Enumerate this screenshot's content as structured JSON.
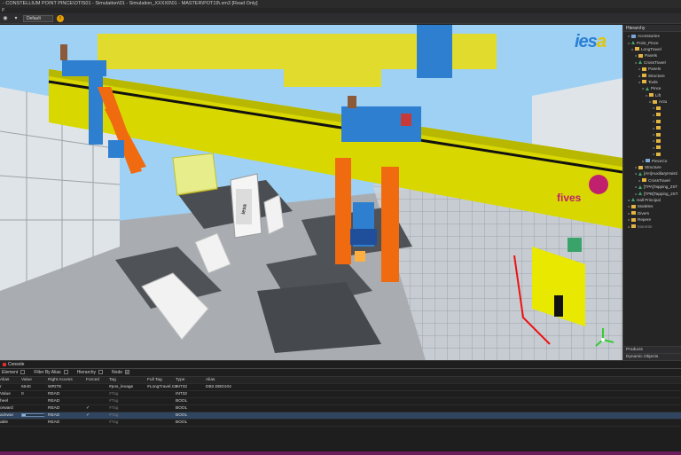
{
  "window": {
    "title": "- CONSTELLIUM POINT PINCE\\OTIS01 - Simulation\\01 - Simulation_XXXX0\\01 - MASTER\\POT19\\.xm3 [Read Only]"
  },
  "toolbar": {
    "select_value": "Default"
  },
  "viewport": {
    "logo_main": "ies",
    "logo_accent": "a",
    "sign_label": "fives",
    "board_label": "iesa"
  },
  "hierarchy": {
    "title": "Hierarchy",
    "items": [
      {
        "label": "Accessories",
        "depth": 1,
        "icon": "cube"
      },
      {
        "label": "Point_Pince",
        "depth": 1,
        "icon": "tri"
      },
      {
        "label": "LongTravel",
        "depth": 2,
        "icon": "folder"
      },
      {
        "label": "Panels",
        "depth": 3,
        "icon": "folder"
      },
      {
        "label": "CrossTravel",
        "depth": 3,
        "icon": "tri"
      },
      {
        "label": "Panels",
        "depth": 4,
        "icon": "folder"
      },
      {
        "label": "Structure",
        "depth": 4,
        "icon": "folder"
      },
      {
        "label": "Tools",
        "depth": 4,
        "icon": "folder"
      },
      {
        "label": "Pince",
        "depth": 5,
        "icon": "tri"
      },
      {
        "label": "Lift",
        "depth": 6,
        "icon": "folder"
      },
      {
        "label": "Actu",
        "depth": 7,
        "icon": "folder"
      },
      {
        "label": "",
        "depth": 8,
        "icon": "folder"
      },
      {
        "label": "",
        "depth": 8,
        "icon": "folder"
      },
      {
        "label": "",
        "depth": 8,
        "icon": "folder"
      },
      {
        "label": "",
        "depth": 8,
        "icon": "folder"
      },
      {
        "label": "",
        "depth": 8,
        "icon": "folder"
      },
      {
        "label": "",
        "depth": 8,
        "icon": "folder"
      },
      {
        "label": "",
        "depth": 8,
        "icon": "folder"
      },
      {
        "label": "",
        "depth": 8,
        "icon": "folder"
      },
      {
        "label": "PieceCo",
        "depth": 5,
        "icon": "cube"
      },
      {
        "label": "Structure",
        "depth": 3,
        "icon": "folder"
      },
      {
        "label": "[AH]AuxiliaryHoisti",
        "depth": 3,
        "icon": "tri"
      },
      {
        "label": "CrossTravel",
        "depth": 4,
        "icon": "folder"
      },
      {
        "label": "[TPA]Tapping_2ST",
        "depth": 3,
        "icon": "tri"
      },
      {
        "label": "[TPB]Tapping_2ST",
        "depth": 3,
        "icon": "tri"
      },
      {
        "label": "Hall Principal",
        "depth": 1,
        "icon": "tri"
      },
      {
        "label": "Modeles",
        "depth": 1,
        "icon": "folder"
      },
      {
        "label": "Divers",
        "depth": 1,
        "icon": "folder"
      },
      {
        "label": "Repere",
        "depth": 1,
        "icon": "folder"
      },
      {
        "label": "Manette",
        "depth": 1,
        "icon": "folder",
        "dim": true
      }
    ],
    "bottom_panels": [
      "Products",
      "Dynamic Objects"
    ]
  },
  "console": {
    "tabs": [
      "Console"
    ],
    "filters": {
      "element": "Element",
      "filter_by_alias": "Filter By Alias",
      "hierarchy": "Hierarchy",
      "node": "Node"
    },
    "columns": [
      "Alias",
      "Value",
      "Right Access",
      "Forced",
      "Tag",
      "Full Tag",
      "Type",
      "Alias"
    ],
    "rows": [
      {
        "c0": "r",
        "c1": "5640",
        "c2": "WRITE",
        "c3": "",
        "c4": "#pos_levage",
        "c5": "#LongTravel.Cn",
        "c6": "INT32",
        "c7": "DB2.DBD104",
        "tagdim": false
      },
      {
        "c0": "Value",
        "c1": "0",
        "c2": "READ",
        "c3": "",
        "c4": "#Tag",
        "c5": "",
        "c6": "INT32",
        "c7": "",
        "tagdim": true
      },
      {
        "c0": "heel",
        "c1": "",
        "c2": "READ",
        "c3": "",
        "c4": "#Tag",
        "c5": "",
        "c6": "BOOL",
        "c7": "",
        "tagdim": true
      },
      {
        "c0": "orward",
        "c1": "",
        "c2": "READ",
        "c3": "✓",
        "c4": "#Tag",
        "c5": "",
        "c6": "BOOL",
        "c7": "",
        "tagdim": true
      },
      {
        "c0": "ackwar",
        "c1": "bar",
        "c2": "READ",
        "c3": "✓",
        "c4": "#Tag",
        "c5": "",
        "c6": "BOOL",
        "c7": "",
        "tagdim": true,
        "selected": true
      },
      {
        "c0": "able",
        "c1": "",
        "c2": "READ",
        "c3": "",
        "c4": "#Tag",
        "c5": "",
        "c6": "BOOL",
        "c7": "",
        "tagdim": true
      }
    ]
  },
  "colors": {
    "beam": "#d8d800",
    "frame": "#2f7fd0",
    "arm": "#f06a10",
    "sky": "#9fd1f4",
    "status": "#6a1f5a"
  }
}
